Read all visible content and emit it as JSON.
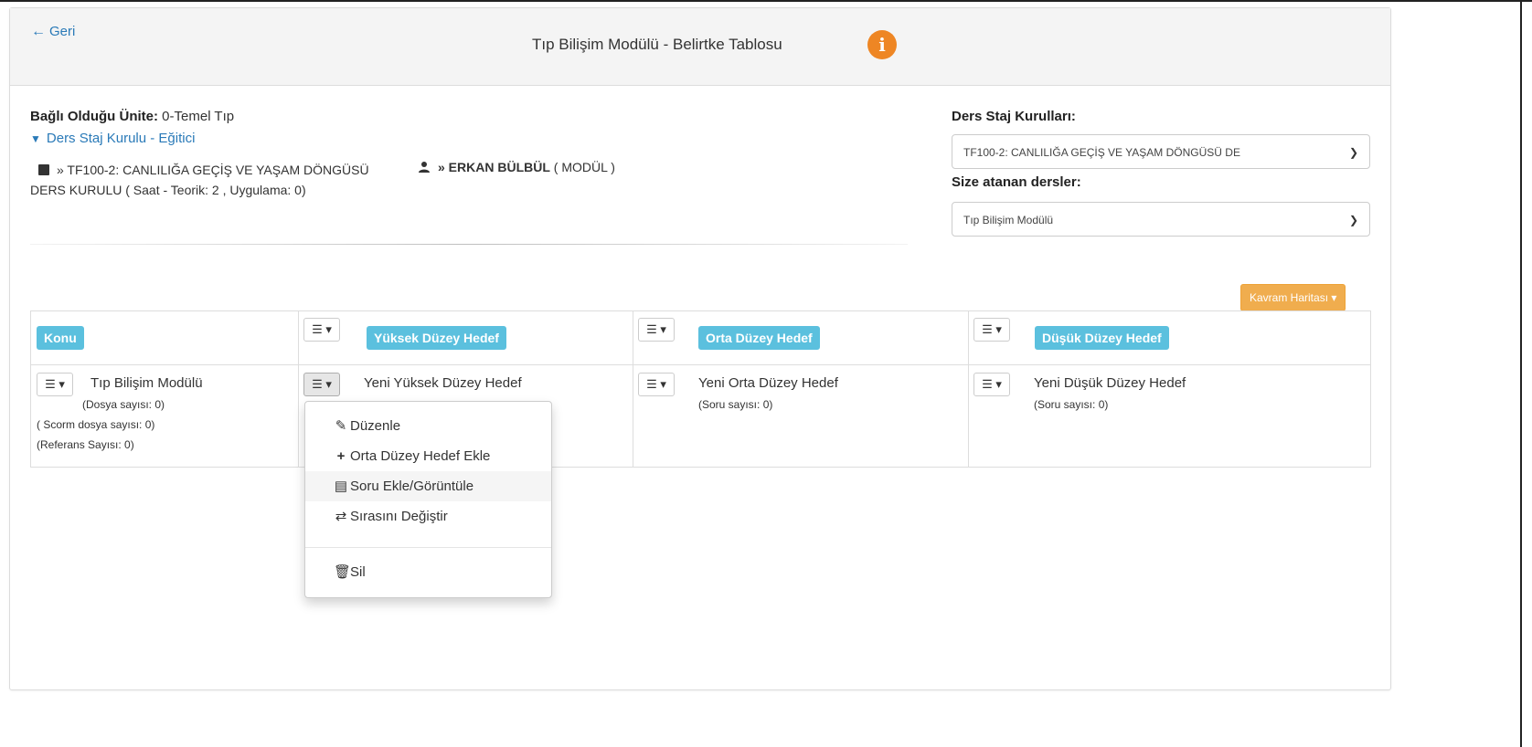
{
  "header": {
    "back_label": "Geri",
    "title": "Tıp Bilişim Modülü - Belirtke Tablosu",
    "info_icon": "info-icon",
    "info_color": "#ee8624"
  },
  "info": {
    "unit_label": "Bağlı Olduğu Ünite:",
    "unit_value": "0-Temel Tıp",
    "collapse_label": "Ders Staj Kurulu - Eğitici",
    "course_text": "» TF100-2: CANLILIĞA GEÇİŞ VE YAŞAM DÖNGÜSÜ DERS KURULU",
    "course_hours": "( Saat - Teorik: 2 , Uygulama: 0)",
    "person_name": "» ERKAN BÜLBÜL",
    "person_role": "( MODÜL )"
  },
  "side": {
    "kurullar_label": "Ders Staj Kurulları:",
    "kurullar_value": "TF100-2: CANLILIĞA GEÇİŞ VE YAŞAM DÖNGÜSÜ DE",
    "dersler_label": "Size atanan dersler:",
    "dersler_value": "Tıp Bilişim Modülü"
  },
  "kavram_button": "Kavram Haritası ▾",
  "table": {
    "headers": {
      "konu": "Konu",
      "yuksek": "Yüksek Düzey Hedef",
      "orta": "Orta Düzey Hedef",
      "dusuk": "Düşük Düzey Hedef"
    },
    "menu_btn": "☰ ▾",
    "row": {
      "konu_title": "Tıp Bilişim Modülü",
      "konu_dosya": "(Dosya sayısı: 0)",
      "konu_scorm": "( Scorm dosya sayısı: 0)",
      "konu_referans": "(Referans Sayısı: 0)",
      "yuksek_title": "Yeni Yüksek Düzey Hedef",
      "orta_title": "Yeni Orta Düzey Hedef",
      "orta_soru": "(Soru sayısı: 0)",
      "dusuk_title": "Yeni Düşük Düzey Hedef",
      "dusuk_soru": "(Soru sayısı: 0)"
    }
  },
  "dropdown": {
    "items": [
      {
        "label": "Düzenle",
        "icon": "pencil-icon"
      },
      {
        "label": "Orta Düzey Hedef Ekle",
        "icon": "plus-icon"
      },
      {
        "label": "Soru Ekle/Görüntüle",
        "icon": "list-icon"
      },
      {
        "label": "Sırasını Değiştir",
        "icon": "swap-icon"
      },
      {
        "label": "Sil",
        "icon": "trash-icon"
      }
    ]
  }
}
